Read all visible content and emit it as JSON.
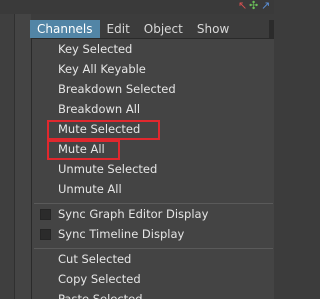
{
  "menubar": {
    "items": [
      "Channels",
      "Edit",
      "Object",
      "Show"
    ],
    "active": "Channels"
  },
  "toolbar_icons": [
    "red-arrow-icon",
    "green-cross-icon",
    "blue-arrow-icon"
  ],
  "menu": {
    "key_selected": "Key Selected",
    "key_all_keyable": "Key All Keyable",
    "breakdown_selected": "Breakdown Selected",
    "breakdown_all": "Breakdown All",
    "mute_selected": "Mute Selected",
    "mute_all": "Mute All",
    "unmute_selected": "Unmute Selected",
    "unmute_all": "Unmute All",
    "sync_graph_editor": "Sync Graph Editor Display",
    "sync_timeline": "Sync Timeline Display",
    "cut_selected": "Cut Selected",
    "copy_selected": "Copy Selected",
    "paste_selected": "Paste Selected"
  },
  "highlight_color": "#e0282e",
  "active_menu_color": "#5285a6"
}
